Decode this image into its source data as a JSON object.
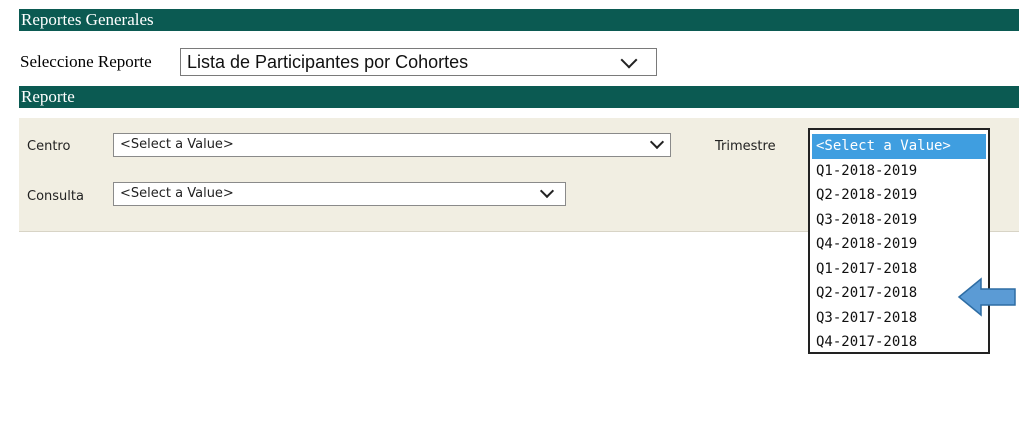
{
  "header": {
    "title": "Reportes Generales"
  },
  "report_selector": {
    "label": "Seleccione Reporte",
    "value": "Lista de Participantes por Cohortes"
  },
  "section": {
    "title": "Reporte"
  },
  "filters": {
    "centro": {
      "label": "Centro",
      "value": "<Select a Value>"
    },
    "consulta": {
      "label": "Consulta",
      "value": "<Select a Value>"
    },
    "trimestre": {
      "label": "Trimestre",
      "options": [
        "<Select a Value>",
        "Q1-2018-2019",
        "Q2-2018-2019",
        "Q3-2018-2019",
        "Q4-2018-2019",
        "Q1-2017-2018",
        "Q2-2017-2018",
        "Q3-2017-2018",
        "Q4-2017-2018"
      ],
      "selected_index": 0
    }
  },
  "colors": {
    "header_bar": "#0b5a52",
    "panel_bg": "#f1eee2",
    "selected_option": "#3f9ee0",
    "arrow": "#5b9bd5"
  },
  "annotation": {
    "icon": "left-arrow-icon"
  }
}
